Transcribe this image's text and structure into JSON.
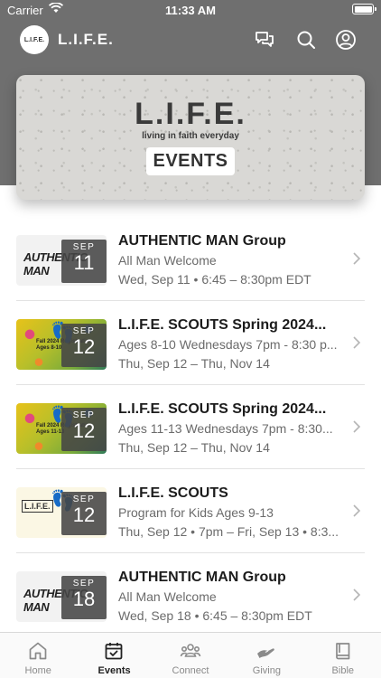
{
  "status_bar": {
    "carrier": "Carrier",
    "time": "11:33 AM"
  },
  "header": {
    "logo_text": "L.I.F.E.",
    "title": "L.I.F.E."
  },
  "banner": {
    "brand": "L.I.F.E.",
    "tagline": "living in faith everyday",
    "tag": "EVENTS"
  },
  "events": [
    {
      "thumb": "man",
      "thumb_text": "AUTHENTIC MAN",
      "month": "SEP",
      "day": "11",
      "title": "AUTHENTIC MAN Group",
      "subtitle": "All Man Welcome",
      "when": "Wed, Sep 11 • 6:45 – 8:30pm EDT"
    },
    {
      "thumb": "scouts",
      "thumb_text": "Fall 2024 Registration Ages 8-10",
      "month": "SEP",
      "day": "12",
      "title": "L.I.F.E. SCOUTS Spring 2024...",
      "subtitle": "Ages 8-10 Wednesdays 7pm - 8:30 p...",
      "when": "Thu, Sep 12 – Thu, Nov 14"
    },
    {
      "thumb": "scouts",
      "thumb_text": "Fall 2024 Registration Ages 11-13",
      "month": "SEP",
      "day": "12",
      "title": "L.I.F.E. SCOUTS Spring 2024...",
      "subtitle": "Ages 11-13 Wednesdays 7pm - 8:30...",
      "when": "Thu, Sep 12 – Thu, Nov 14"
    },
    {
      "thumb": "kids",
      "thumb_text": "L.I.F.E.",
      "month": "SEP",
      "day": "12",
      "title": "L.I.F.E. SCOUTS",
      "subtitle": "Program for Kids Ages 9-13",
      "when": "Thu, Sep 12 • 7pm – Fri, Sep 13 • 8:3..."
    },
    {
      "thumb": "man",
      "thumb_text": "AUTHENTIC MAN",
      "month": "SEP",
      "day": "18",
      "title": "AUTHENTIC MAN Group",
      "subtitle": "All Man Welcome",
      "when": "Wed, Sep 18 • 6:45 – 8:30pm EDT"
    }
  ],
  "tabs": [
    {
      "label": "Home",
      "icon": "home-icon",
      "active": false
    },
    {
      "label": "Events",
      "icon": "calendar-check-icon",
      "active": true
    },
    {
      "label": "Connect",
      "icon": "people-icon",
      "active": false
    },
    {
      "label": "Giving",
      "icon": "giving-hand-icon",
      "active": false
    },
    {
      "label": "Bible",
      "icon": "book-icon",
      "active": false
    }
  ],
  "colors": {
    "header_bg": "#6f6f6f",
    "active_tab": "#222222",
    "inactive_tab": "#8a8a8a"
  }
}
